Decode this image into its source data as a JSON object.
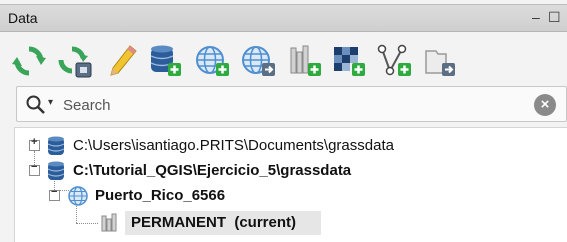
{
  "panel": {
    "title": "Data",
    "controls": {
      "minimize": "–",
      "float": "☐"
    }
  },
  "toolbar": {
    "buttons": [
      {
        "icon": "refresh-icon"
      },
      {
        "icon": "refresh-database-icon"
      },
      {
        "icon": "pencil-icon"
      },
      {
        "icon": "new-database-icon"
      },
      {
        "icon": "new-location-icon"
      },
      {
        "icon": "import-location-icon"
      },
      {
        "icon": "new-mapset-icon"
      },
      {
        "icon": "import-raster-icon"
      },
      {
        "icon": "import-vector-icon"
      },
      {
        "icon": "export-icon"
      }
    ]
  },
  "search": {
    "placeholder": "Search",
    "dropdown_arrow": "▾",
    "clear_glyph": "×"
  },
  "tree": {
    "nodes": [
      {
        "label": "C:\\Users\\isantiago.PRITS\\Documents\\grassdata",
        "expander": "+",
        "icon": "database-icon",
        "bold": false
      },
      {
        "label": "C:\\Tutorial_QGIS\\Ejercicio_5\\grassdata",
        "expander": "−",
        "icon": "database-icon",
        "bold": true
      },
      {
        "label": "Puerto_Rico_6566",
        "expander": "−",
        "icon": "globe-icon",
        "bold": true
      },
      {
        "label": "PERMANENT  (current)",
        "icon": "mapset-icon",
        "bold": true,
        "selected": true
      }
    ]
  },
  "colors": {
    "refresh_green": "#3aa55a",
    "database_blue": "#2a5d9a",
    "globe_blue": "#4f8fd0",
    "add_badge_green": "#2eaa3f",
    "selection_bg": "#e6e6e6"
  }
}
